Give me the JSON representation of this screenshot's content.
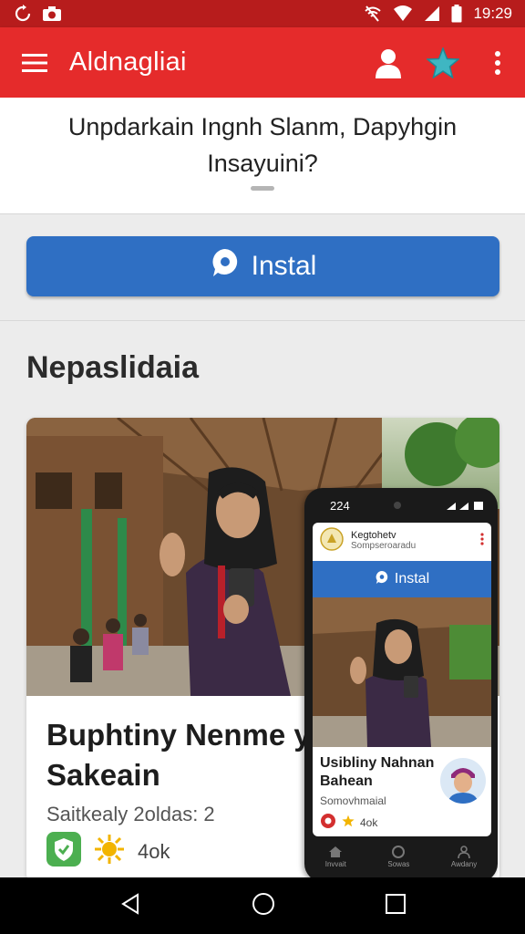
{
  "status_bar": {
    "time": "19:29"
  },
  "app_bar": {
    "title": "Aldnagliai",
    "icons": [
      "menu-icon",
      "account-icon",
      "star-icon",
      "more-vert-icon"
    ]
  },
  "question": {
    "text": "Unpdarkain Ingnh Slanm, Dapyhgin Insayuini?"
  },
  "install_button": {
    "label": "Instal",
    "color": "#2f6fc3"
  },
  "section": {
    "title": "Nepaslidaia"
  },
  "card": {
    "title": "Buphtiny Nenme y Sakeain",
    "meta": "Saitkealy 2oldas: 2",
    "count": "4ok"
  },
  "phone": {
    "time": "224",
    "app_name": "Kegtohetv",
    "app_sub": "Sompseroaradu",
    "install_label": "Instal",
    "card_title": "Usibliny Nahnan Bahean",
    "card_meta": "Somovhmaial",
    "card_count": "4ok",
    "nav": [
      "Invvait",
      "Sowas",
      "Awdany"
    ]
  },
  "colors": {
    "accent": "#e52b2b",
    "status": "#b71c1c",
    "primary": "#2f6fc3"
  }
}
